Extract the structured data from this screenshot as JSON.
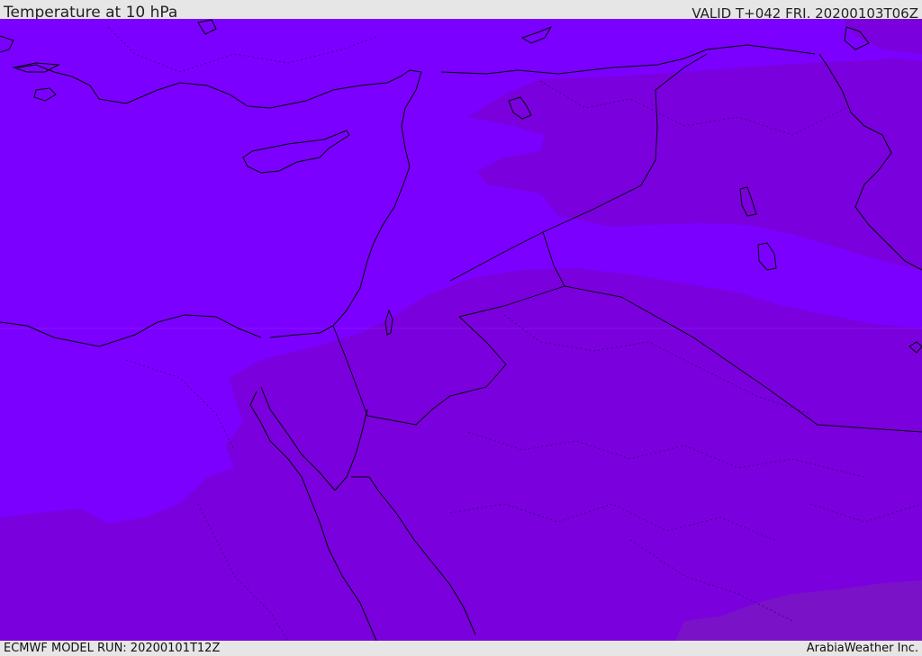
{
  "header": {
    "title": "Temperature at 10 hPa",
    "valid": "VALID T+042 FRI. 20200103T06Z"
  },
  "footer": {
    "model_run": "ECMWF MODEL RUN: 20200101T12Z",
    "credit": "ArabiaWeather Inc."
  },
  "colors": {
    "warm_band": "#7c00ff",
    "cool_band": "#7a00dd",
    "coldest_band": "#7a12c8",
    "coastline": "#000000",
    "border": "#1a0040",
    "bar_background": "#e6e6e6"
  }
}
